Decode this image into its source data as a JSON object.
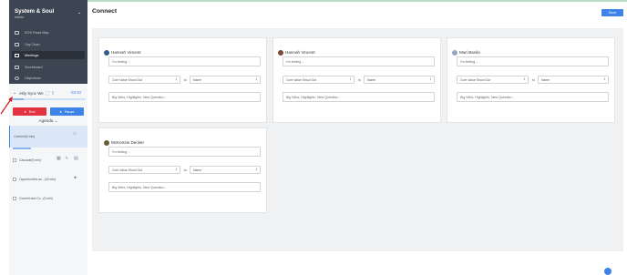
{
  "app": {
    "brand": "System & Soul",
    "role": "Admin"
  },
  "nav": [
    {
      "label": "EOS Road Map",
      "icon": "map-icon"
    },
    {
      "label": "Org Chart",
      "icon": "org-chart-icon"
    },
    {
      "label": "Meetings",
      "icon": "calendar-icon",
      "active": true
    },
    {
      "label": "Scoreboard",
      "icon": "scoreboard-icon"
    },
    {
      "label": "Objectives",
      "icon": "target-icon"
    }
  ],
  "meeting": {
    "name": "ekly Sync  We",
    "timer": "03:10",
    "progress": 0.15,
    "end_label": "End",
    "pause_label": "Pause",
    "agenda_label": "Agenda",
    "agenda_items": [
      {
        "label": "Connect(5 min)",
        "active": true
      },
      {
        "label": "Cascade(5 min)"
      },
      {
        "label": "Opportunities an...(40 min)"
      },
      {
        "label": "Commit and Co...(5 min)"
      }
    ]
  },
  "page": {
    "title": "Connect",
    "save_label": "Save"
  },
  "cards": [
    {
      "name": "Hannah Vincent",
      "avatar_color": "#2f5d8a"
    },
    {
      "name": "Hannah Vincent",
      "avatar_color": "#7a4a32"
    },
    {
      "name": "Mari Banilo",
      "avatar_color": "#9aa6c4"
    },
    {
      "name": "McKenzie Decker",
      "avatar_color": "#6b5b3a"
    }
  ],
  "card_fields": {
    "feeling_placeholder": "I'm feeling ...",
    "core_value_placeholder": "Core Value Shout Out",
    "to_label": "to",
    "name_placeholder": "Name",
    "big_wins_placeholder": "Big Wins, Highlights, New Question..."
  },
  "colors": {
    "accent": "#3d83e8",
    "danger": "#e33340",
    "sidebar_dark": "#3c4552"
  }
}
